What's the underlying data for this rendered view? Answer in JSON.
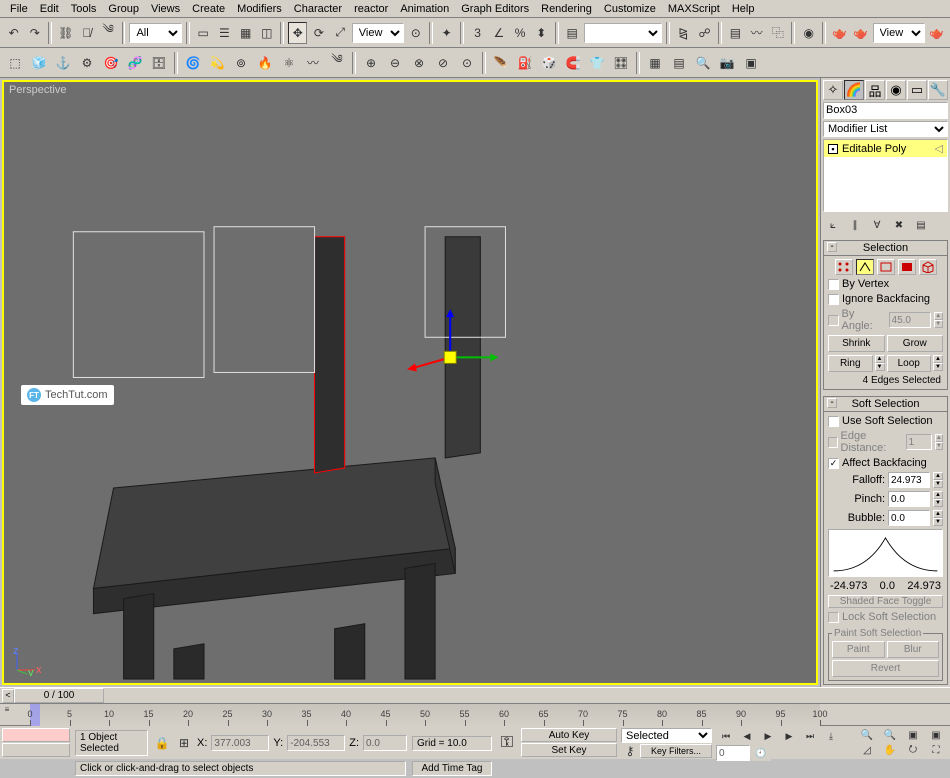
{
  "menu": [
    "File",
    "Edit",
    "Tools",
    "Group",
    "Views",
    "Create",
    "Modifiers",
    "Character",
    "reactor",
    "Animation",
    "Graph Editors",
    "Rendering",
    "Customize",
    "MAXScript",
    "Help"
  ],
  "toolbar1": {
    "filter_combo": "All",
    "view_combo": "View"
  },
  "viewport": {
    "label": "Perspective"
  },
  "watermark": "TechTut.com",
  "side": {
    "object_name": "Box03",
    "modifier_list": "Modifier List",
    "stack_item": "Editable Poly",
    "selection": {
      "title": "Selection",
      "by_vertex": "By Vertex",
      "ignore_bf": "Ignore Backfacing",
      "by_angle": "By Angle:",
      "by_angle_val": "45.0",
      "shrink": "Shrink",
      "grow": "Grow",
      "ring": "Ring",
      "loop": "Loop",
      "status": "4 Edges Selected"
    },
    "softsel": {
      "title": "Soft Selection",
      "use": "Use Soft Selection",
      "edge_dist": "Edge Distance:",
      "edge_dist_val": "1",
      "affect_bf": "Affect Backfacing",
      "falloff": "Falloff:",
      "falloff_val": "24.973",
      "pinch": "Pinch:",
      "pinch_val": "0.0",
      "bubble": "Bubble:",
      "bubble_val": "0.0",
      "lmin": "-24.973",
      "lmid": "0.0",
      "lmax": "24.973",
      "shaded": "Shaded Face Toggle",
      "lock": "Lock Soft Selection",
      "paint_group": "Paint Soft Selection",
      "paint": "Paint",
      "blur": "Blur",
      "revert": "Revert"
    }
  },
  "timeslider": {
    "label": "0 / 100"
  },
  "ruler": {
    "min": 0,
    "max": 100,
    "step": 5
  },
  "status": {
    "sel": "1 Object Selected",
    "prompt": "Click or click-and-drag to select objects",
    "x": "377.003",
    "y": "-204.553",
    "z": "0.0",
    "grid": "Grid = 10.0",
    "autokey": "Auto Key",
    "setkey": "Set Key",
    "selected_combo": "Selected",
    "keyfilters": "Key Filters...",
    "addtimetag": "Add Time Tag",
    "view_combo": "View"
  }
}
